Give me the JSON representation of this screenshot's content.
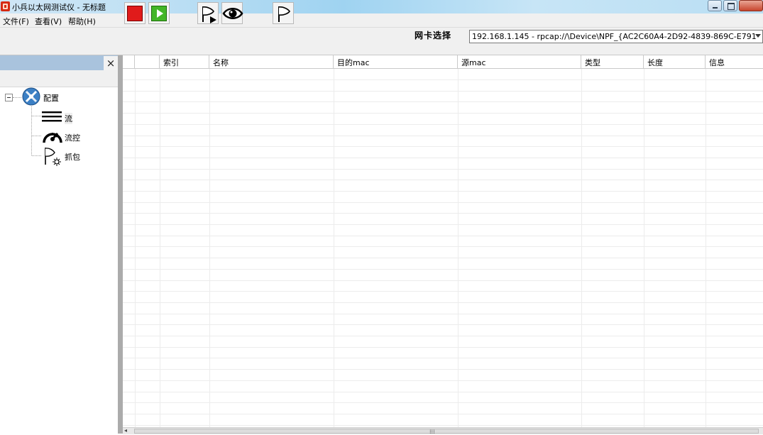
{
  "window": {
    "title": "小兵以太网测试仪 - 无标题"
  },
  "menu": {
    "items": [
      "文件(F)",
      "查看(V)",
      "帮助(H)"
    ]
  },
  "toolbar": {
    "nic_label": "网卡选择",
    "nic_value": "192.168.1.145 - rpcap://\\Device\\NPF_{AC2C60A4-2D92-4839-869C-E791"
  },
  "left_panel": {
    "close_glyph": "×",
    "tree": {
      "root_label": "配置",
      "children": [
        "流",
        "流控",
        "抓包"
      ]
    }
  },
  "grid": {
    "columns": [
      "",
      "索引",
      "名称",
      "目的mac",
      "源mac",
      "类型",
      "长度",
      "信息"
    ],
    "rows": []
  },
  "colors": {
    "stop_button": "#e01b1b",
    "start_button": "#43b628",
    "panel_header": "#a9c3dd"
  },
  "icons": {
    "stop": "stop-icon",
    "start": "play-icon",
    "capture_start": "flag-play-icon",
    "view": "eye-icon",
    "capture": "flag-icon",
    "config": "tools-globe-icon",
    "stream": "lines-icon",
    "flow_control": "gauge-icon",
    "packet_capture": "flag-gear-icon"
  }
}
